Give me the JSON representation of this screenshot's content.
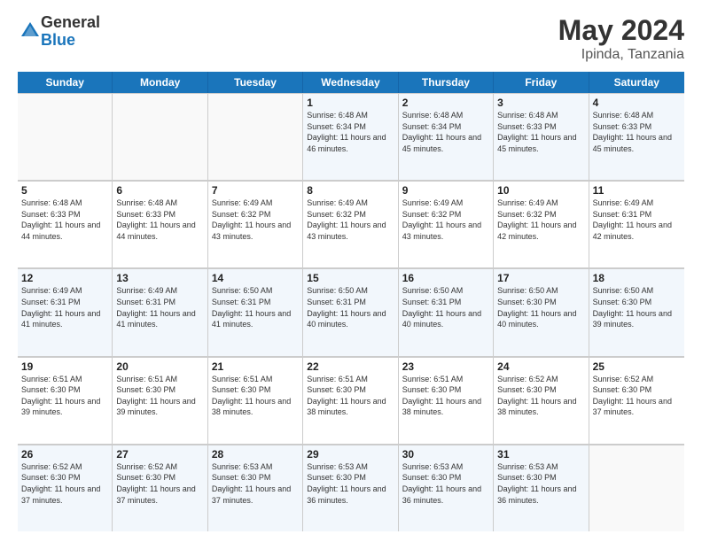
{
  "logo": {
    "general": "General",
    "blue": "Blue"
  },
  "title": {
    "month_year": "May 2024",
    "location": "Ipinda, Tanzania"
  },
  "days_of_week": [
    "Sunday",
    "Monday",
    "Tuesday",
    "Wednesday",
    "Thursday",
    "Friday",
    "Saturday"
  ],
  "weeks": [
    [
      {
        "day": "",
        "empty": true
      },
      {
        "day": "",
        "empty": true
      },
      {
        "day": "",
        "empty": true
      },
      {
        "day": "1",
        "sunrise": "6:48 AM",
        "sunset": "6:34 PM",
        "daylight": "11 hours and 46 minutes."
      },
      {
        "day": "2",
        "sunrise": "6:48 AM",
        "sunset": "6:34 PM",
        "daylight": "11 hours and 45 minutes."
      },
      {
        "day": "3",
        "sunrise": "6:48 AM",
        "sunset": "6:33 PM",
        "daylight": "11 hours and 45 minutes."
      },
      {
        "day": "4",
        "sunrise": "6:48 AM",
        "sunset": "6:33 PM",
        "daylight": "11 hours and 45 minutes."
      }
    ],
    [
      {
        "day": "5",
        "sunrise": "6:48 AM",
        "sunset": "6:33 PM",
        "daylight": "11 hours and 44 minutes."
      },
      {
        "day": "6",
        "sunrise": "6:48 AM",
        "sunset": "6:33 PM",
        "daylight": "11 hours and 44 minutes."
      },
      {
        "day": "7",
        "sunrise": "6:49 AM",
        "sunset": "6:32 PM",
        "daylight": "11 hours and 43 minutes."
      },
      {
        "day": "8",
        "sunrise": "6:49 AM",
        "sunset": "6:32 PM",
        "daylight": "11 hours and 43 minutes."
      },
      {
        "day": "9",
        "sunrise": "6:49 AM",
        "sunset": "6:32 PM",
        "daylight": "11 hours and 43 minutes."
      },
      {
        "day": "10",
        "sunrise": "6:49 AM",
        "sunset": "6:32 PM",
        "daylight": "11 hours and 42 minutes."
      },
      {
        "day": "11",
        "sunrise": "6:49 AM",
        "sunset": "6:31 PM",
        "daylight": "11 hours and 42 minutes."
      }
    ],
    [
      {
        "day": "12",
        "sunrise": "6:49 AM",
        "sunset": "6:31 PM",
        "daylight": "11 hours and 41 minutes."
      },
      {
        "day": "13",
        "sunrise": "6:49 AM",
        "sunset": "6:31 PM",
        "daylight": "11 hours and 41 minutes."
      },
      {
        "day": "14",
        "sunrise": "6:50 AM",
        "sunset": "6:31 PM",
        "daylight": "11 hours and 41 minutes."
      },
      {
        "day": "15",
        "sunrise": "6:50 AM",
        "sunset": "6:31 PM",
        "daylight": "11 hours and 40 minutes."
      },
      {
        "day": "16",
        "sunrise": "6:50 AM",
        "sunset": "6:31 PM",
        "daylight": "11 hours and 40 minutes."
      },
      {
        "day": "17",
        "sunrise": "6:50 AM",
        "sunset": "6:30 PM",
        "daylight": "11 hours and 40 minutes."
      },
      {
        "day": "18",
        "sunrise": "6:50 AM",
        "sunset": "6:30 PM",
        "daylight": "11 hours and 39 minutes."
      }
    ],
    [
      {
        "day": "19",
        "sunrise": "6:51 AM",
        "sunset": "6:30 PM",
        "daylight": "11 hours and 39 minutes."
      },
      {
        "day": "20",
        "sunrise": "6:51 AM",
        "sunset": "6:30 PM",
        "daylight": "11 hours and 39 minutes."
      },
      {
        "day": "21",
        "sunrise": "6:51 AM",
        "sunset": "6:30 PM",
        "daylight": "11 hours and 38 minutes."
      },
      {
        "day": "22",
        "sunrise": "6:51 AM",
        "sunset": "6:30 PM",
        "daylight": "11 hours and 38 minutes."
      },
      {
        "day": "23",
        "sunrise": "6:51 AM",
        "sunset": "6:30 PM",
        "daylight": "11 hours and 38 minutes."
      },
      {
        "day": "24",
        "sunrise": "6:52 AM",
        "sunset": "6:30 PM",
        "daylight": "11 hours and 38 minutes."
      },
      {
        "day": "25",
        "sunrise": "6:52 AM",
        "sunset": "6:30 PM",
        "daylight": "11 hours and 37 minutes."
      }
    ],
    [
      {
        "day": "26",
        "sunrise": "6:52 AM",
        "sunset": "6:30 PM",
        "daylight": "11 hours and 37 minutes."
      },
      {
        "day": "27",
        "sunrise": "6:52 AM",
        "sunset": "6:30 PM",
        "daylight": "11 hours and 37 minutes."
      },
      {
        "day": "28",
        "sunrise": "6:53 AM",
        "sunset": "6:30 PM",
        "daylight": "11 hours and 37 minutes."
      },
      {
        "day": "29",
        "sunrise": "6:53 AM",
        "sunset": "6:30 PM",
        "daylight": "11 hours and 36 minutes."
      },
      {
        "day": "30",
        "sunrise": "6:53 AM",
        "sunset": "6:30 PM",
        "daylight": "11 hours and 36 minutes."
      },
      {
        "day": "31",
        "sunrise": "6:53 AM",
        "sunset": "6:30 PM",
        "daylight": "11 hours and 36 minutes."
      },
      {
        "day": "",
        "empty": true
      }
    ]
  ]
}
